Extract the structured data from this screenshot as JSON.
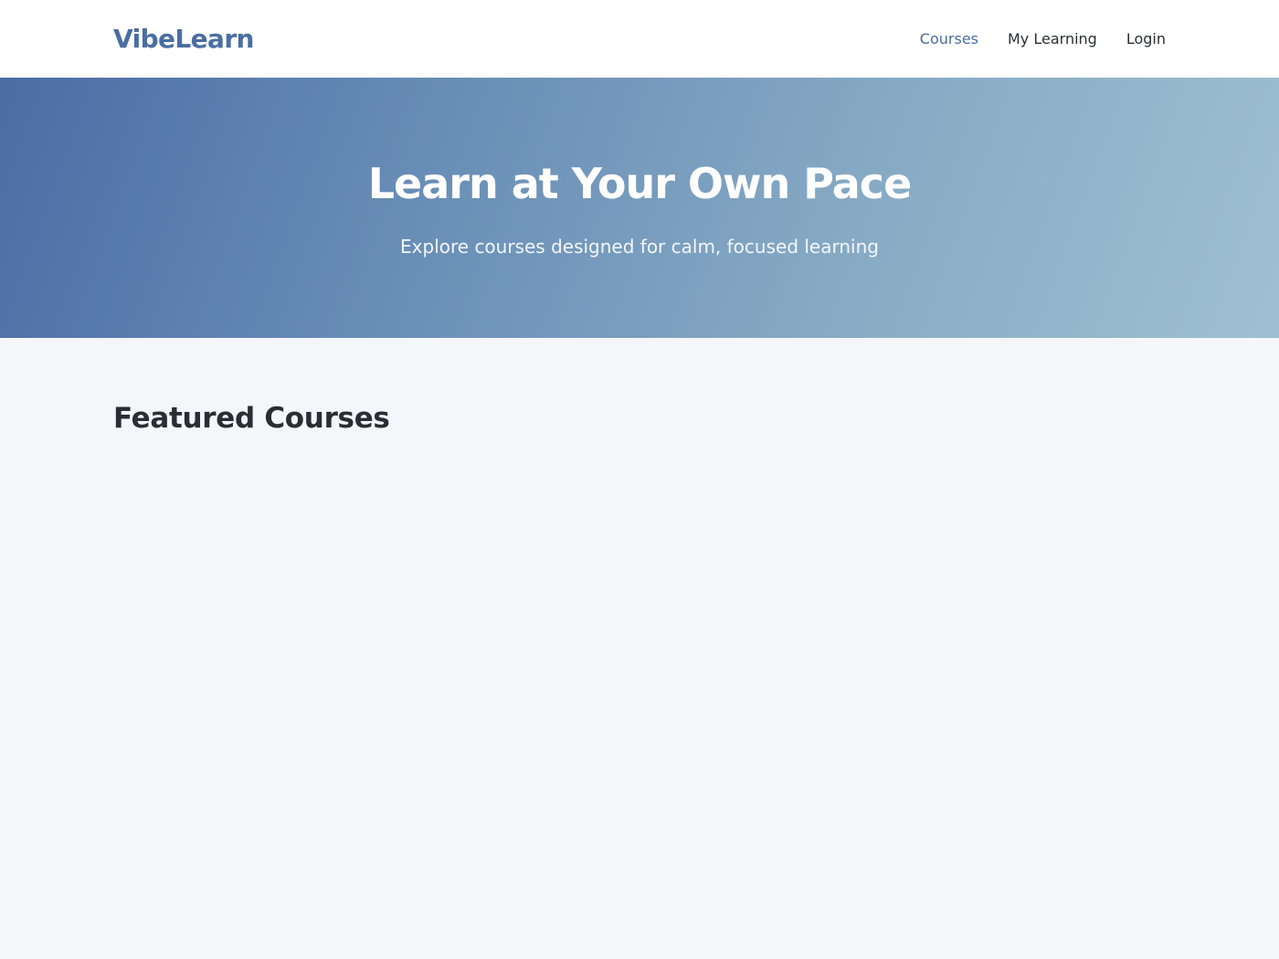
{
  "header": {
    "logo": "VibeLearn",
    "nav": [
      {
        "label": "Courses",
        "active": true
      },
      {
        "label": "My Learning",
        "active": false
      },
      {
        "label": "Login",
        "active": false
      }
    ]
  },
  "hero": {
    "title": "Learn at Your Own Pace",
    "subtitle": "Explore courses designed for calm, focused learning"
  },
  "main": {
    "section_title": "Featured Courses"
  },
  "colors": {
    "brand": "#4a6ea2",
    "page_background": "#f5f6fa",
    "hero_gradient_start": "#4b6ca5",
    "hero_gradient_end": "#9fc0d2",
    "text": "#2b2d33"
  }
}
